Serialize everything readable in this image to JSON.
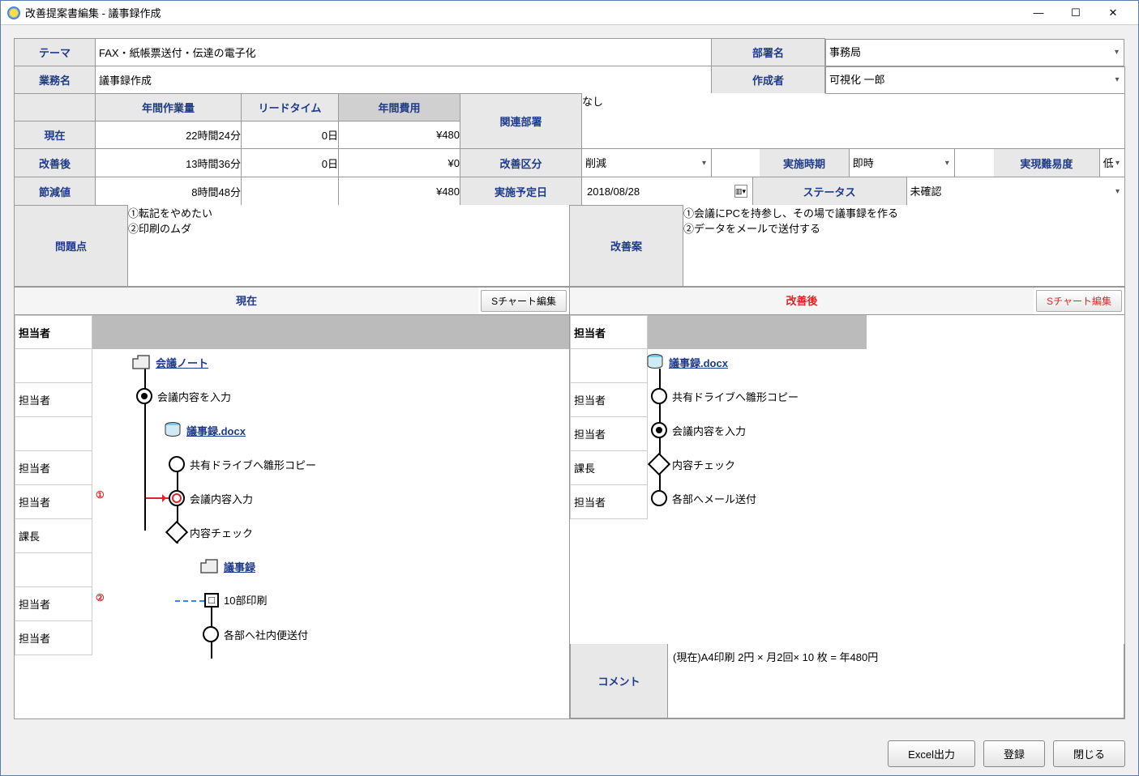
{
  "window": {
    "title": "改善提案書編集 - 議事録作成"
  },
  "winControls": {
    "min": "—",
    "max": "☐",
    "close": "✕"
  },
  "labels": {
    "theme": "テーマ",
    "task": "業務名",
    "dept": "部署名",
    "author": "作成者",
    "workload": "年間作業量",
    "leadtime": "リードタイム",
    "cost": "年間費用",
    "related": "関連部署",
    "now": "現在",
    "after": "改善後",
    "saving": "節減値",
    "improveType": "改善区分",
    "timing": "実施時期",
    "difficulty": "実現難易度",
    "scheduled": "実施予定日",
    "status": "ステータス",
    "problem": "問題点",
    "plan": "改善案",
    "chartEdit": "Sチャート編集",
    "lane": "担当者",
    "comment": "コメント"
  },
  "fields": {
    "theme": "FAX・紙帳票送付・伝達の電子化",
    "task": "議事録作成",
    "dept": "事務局",
    "author": "可視化 一郎",
    "related": "なし",
    "improveType": "削減",
    "timing": "即時",
    "difficulty": "低",
    "scheduled": "2018/08/28",
    "status": "未確認",
    "problem": "①転記をやめたい\n②印刷のムダ",
    "plan": "①会議にPCを持参し、その場で議事録を作る\n②データをメールで送付する",
    "comment": "(現在)A4印刷 2円 × 月2回× 10 枚 = 年480円"
  },
  "metrics": {
    "now": {
      "workload": "22時間24分",
      "leadtime": "0日",
      "cost": "¥480"
    },
    "after": {
      "workload": "13時間36分",
      "leadtime": "0日",
      "cost": "¥0"
    },
    "save": {
      "workload": "8時間48分",
      "leadtime": "",
      "cost": "¥480"
    }
  },
  "chartCurrent": {
    "title": "現在",
    "lanes": [
      "",
      "担当者",
      "",
      "担当者",
      "担当者",
      "課長",
      "",
      "担当者",
      "担当者"
    ],
    "marks": {
      "m1": "①",
      "m2": "②"
    },
    "items": {
      "i0": "会議ノート",
      "i1": "会議内容を入力",
      "i2": "議事録.docx",
      "i3": "共有ドライブへ雛形コピー",
      "i4": "会議内容入力",
      "i5": "内容チェック",
      "i6": "議事録",
      "i7": "10部印刷",
      "i8": "各部へ社内便送付"
    }
  },
  "chartAfter": {
    "title": "改善後",
    "lanes": [
      "",
      "担当者",
      "担当者",
      "課長",
      "担当者"
    ],
    "items": {
      "i0": "議事録.docx",
      "i1": "共有ドライブへ雛形コピー",
      "i2": "会議内容を入力",
      "i3": "内容チェック",
      "i4": "各部へメール送付"
    }
  },
  "footer": {
    "excel": "Excel出力",
    "save": "登録",
    "close": "閉じる"
  }
}
